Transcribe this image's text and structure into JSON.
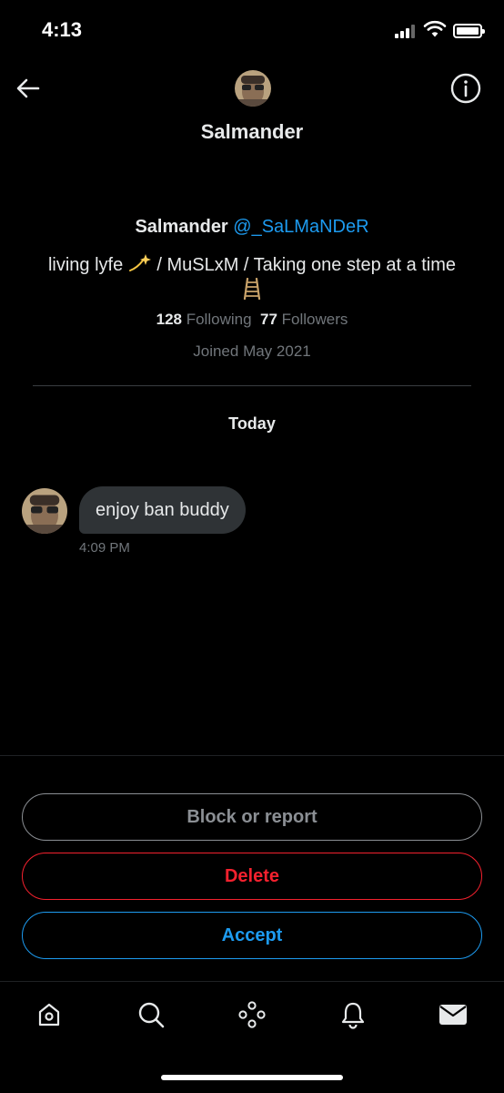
{
  "status_bar": {
    "time": "4:13"
  },
  "header": {
    "title": "Salmander"
  },
  "profile": {
    "name": "Salmander",
    "handle": "@_SaLMaNDeR",
    "bio_part1": "living lyfe",
    "bio_part2": "/ MuSLxM / Taking one step at a time",
    "following_count": "128",
    "following_label": "Following",
    "followers_count": "77",
    "followers_label": "Followers",
    "joined": "Joined May 2021"
  },
  "conversation": {
    "day_label": "Today",
    "messages": [
      {
        "text": "enjoy ban buddy",
        "time": "4:09 PM"
      }
    ]
  },
  "actions": {
    "block_label": "Block or report",
    "delete_label": "Delete",
    "accept_label": "Accept"
  },
  "colors": {
    "accent": "#1d9bf0",
    "danger": "#f4212e",
    "muted": "#71767b",
    "bubble": "#2f3336"
  },
  "tab_bar": {
    "tabs": [
      "home-icon",
      "search-icon",
      "spaces-icon",
      "notifications-icon",
      "messages-icon"
    ],
    "active": "messages-icon"
  }
}
